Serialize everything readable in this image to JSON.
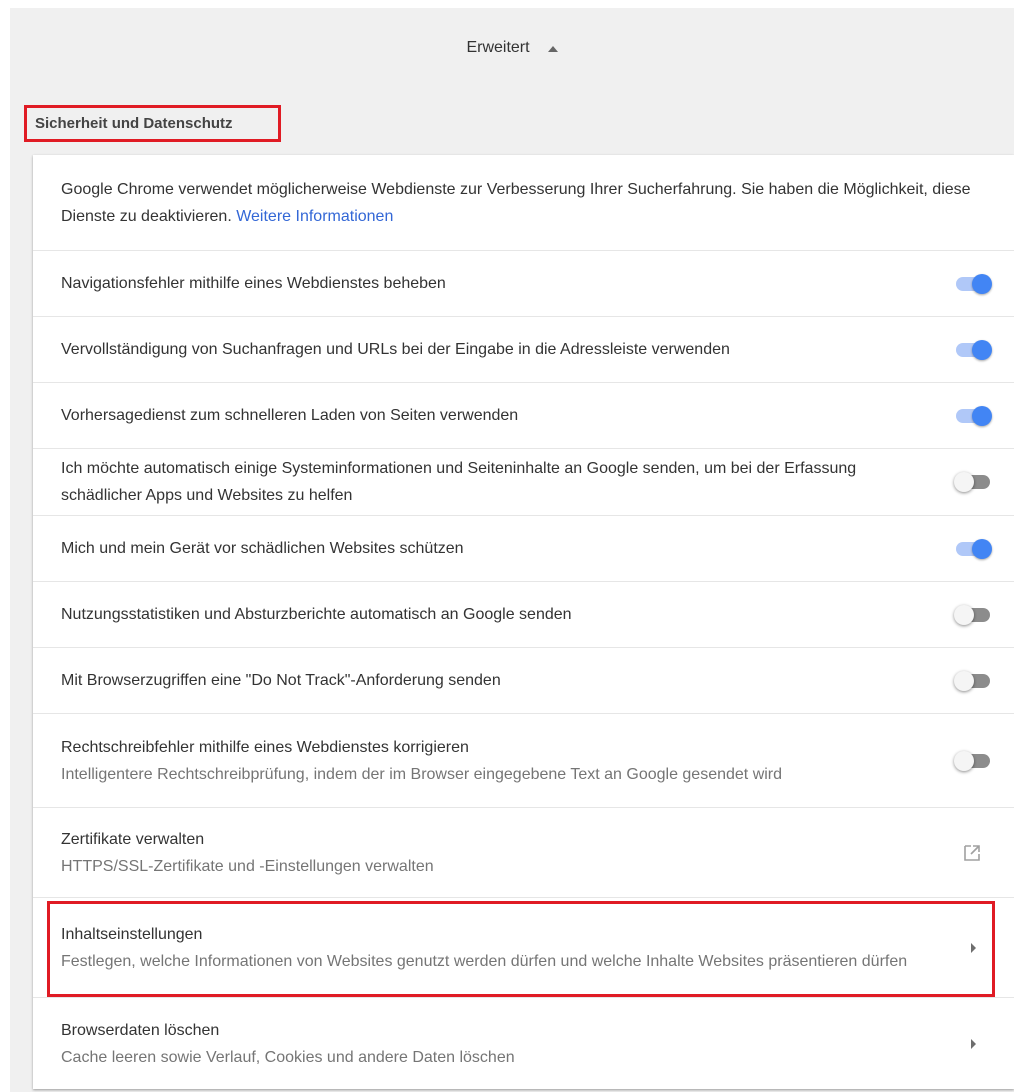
{
  "advanced": {
    "label": "Erweitert"
  },
  "section": {
    "title": "Sicherheit und Datenschutz"
  },
  "intro": {
    "text": "Google Chrome verwendet möglicherweise Webdienste zur Verbesserung Ihrer Sucherfahrung. Sie haben die Möglichkeit, diese Dienste zu deaktivieren.",
    "link": "Weitere Informationen"
  },
  "settings": [
    {
      "label": "Navigationsfehler mithilfe eines Webdienstes beheben",
      "enabled": true
    },
    {
      "label": "Vervollständigung von Suchanfragen und URLs bei der Eingabe in die Adressleiste verwenden",
      "enabled": true
    },
    {
      "label": "Vorhersagedienst zum schnelleren Laden von Seiten verwenden",
      "enabled": true
    },
    {
      "label": "Ich möchte automatisch einige Systeminformationen und Seiteninhalte an Google senden, um bei der Erfassung schädlicher Apps und Websites zu helfen",
      "enabled": false
    },
    {
      "label": "Mich und mein Gerät vor schädlichen Websites schützen",
      "enabled": true
    },
    {
      "label": "Nutzungsstatistiken und Absturzberichte automatisch an Google senden",
      "enabled": false
    },
    {
      "label": "Mit Browserzugriffen eine \"Do Not Track\"-Anforderung senden",
      "enabled": false
    },
    {
      "label": "Rechtschreibfehler mithilfe eines Webdienstes korrigieren",
      "sublabel": "Intelligentere Rechtschreibprüfung, indem der im Browser eingegebene Text an Google gesendet wird",
      "enabled": false
    }
  ],
  "links": [
    {
      "label": "Zertifikate verwalten",
      "sublabel": "HTTPS/SSL-Zertifikate und -Einstellungen verwalten",
      "icon": "external-link-icon"
    },
    {
      "label": "Inhaltseinstellungen",
      "sublabel": "Festlegen, welche Informationen von Websites genutzt werden dürfen und welche Inhalte Websites präsentieren dürfen",
      "icon": "chevron-right-icon"
    },
    {
      "label": "Browserdaten löschen",
      "sublabel": "Cache leeren sowie Verlauf, Cookies und andere Daten löschen",
      "icon": "chevron-right-icon"
    }
  ],
  "colors": {
    "accent": "#4285f4",
    "highlight": "#e01b24",
    "link": "#3367d6"
  }
}
